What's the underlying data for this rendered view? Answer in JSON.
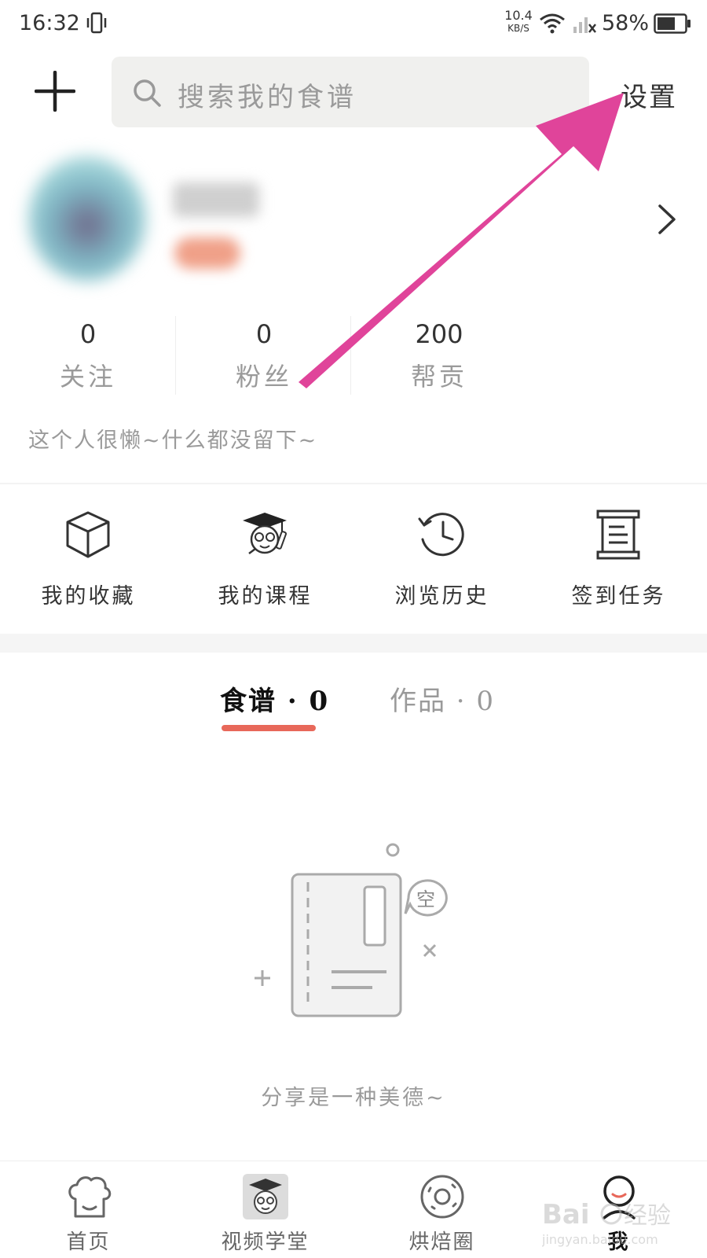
{
  "status_bar": {
    "time": "16:32",
    "net_speed_value": "10.4",
    "net_speed_unit": "KB/S",
    "battery_percent": "58%",
    "icons": [
      "vibrate-icon",
      "wifi-icon",
      "signal-icon",
      "battery-icon"
    ]
  },
  "header": {
    "add_icon": "plus-icon",
    "search_placeholder": "搜索我的食谱",
    "settings_label": "设置"
  },
  "profile": {
    "chevron_icon": "chevron-right-icon"
  },
  "stats": [
    {
      "value": "0",
      "label": "关注"
    },
    {
      "value": "0",
      "label": "粉丝"
    },
    {
      "value": "200",
      "label": "帮贡"
    }
  ],
  "bio": "这个人很懒~什么都没留下~",
  "quick_menu": [
    {
      "label": "我的收藏",
      "icon": "box-icon"
    },
    {
      "label": "我的课程",
      "icon": "graduate-mascot-icon"
    },
    {
      "label": "浏览历史",
      "icon": "history-clock-icon"
    },
    {
      "label": "签到任务",
      "icon": "scroll-icon"
    }
  ],
  "tabs": [
    {
      "label": "食谱 · 0",
      "active": true
    },
    {
      "label": "作品 · 0",
      "active": false
    }
  ],
  "empty_state": {
    "bubble_text": "空",
    "message": "分享是一种美德~"
  },
  "bottom_nav": [
    {
      "label": "首页",
      "icon": "chef-hat-icon",
      "active": false
    },
    {
      "label": "视频学堂",
      "icon": "video-school-icon",
      "active": false
    },
    {
      "label": "烘焙圈",
      "icon": "donut-icon",
      "active": false
    },
    {
      "label": "我",
      "icon": "profile-icon",
      "active": true
    }
  ],
  "watermark": {
    "brand": "Bai",
    "brand_suffix": "经验",
    "url": "jingyan.baidu.com"
  },
  "colors": {
    "accent": "#e8685a",
    "arrow": "#e0449a",
    "muted_text": "#9a9a9a",
    "search_bg": "#f0f0ee"
  }
}
